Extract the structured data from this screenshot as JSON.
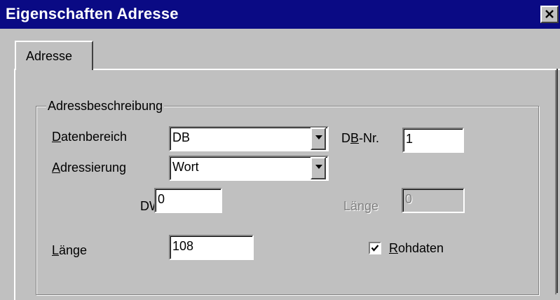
{
  "window": {
    "title": "Eigenschaften Adresse",
    "close_icon": "close-icon"
  },
  "tabs": [
    {
      "label": "Adresse",
      "active": true
    }
  ],
  "group": {
    "title": "Adressbeschreibung"
  },
  "fields": {
    "datenbereich": {
      "label_mnemonic": "D",
      "label_rest": "atenbereich",
      "value": "DB"
    },
    "db_nr": {
      "label_before": "D",
      "label_mnemonic": "B",
      "label_after": "-Nr.",
      "value": "1"
    },
    "adressierung": {
      "label_mnemonic": "A",
      "label_rest": "dressierung",
      "value": "Wort"
    },
    "dw": {
      "label": "DW",
      "value": "0"
    },
    "laenge_disabled": {
      "label": "Länge",
      "value": "0",
      "enabled": false
    },
    "laenge": {
      "label_mnemonic": "L",
      "label_rest": "änge",
      "value": "108"
    },
    "rohdaten": {
      "label_mnemonic": "R",
      "label_rest": "ohdaten",
      "checked": true
    }
  }
}
